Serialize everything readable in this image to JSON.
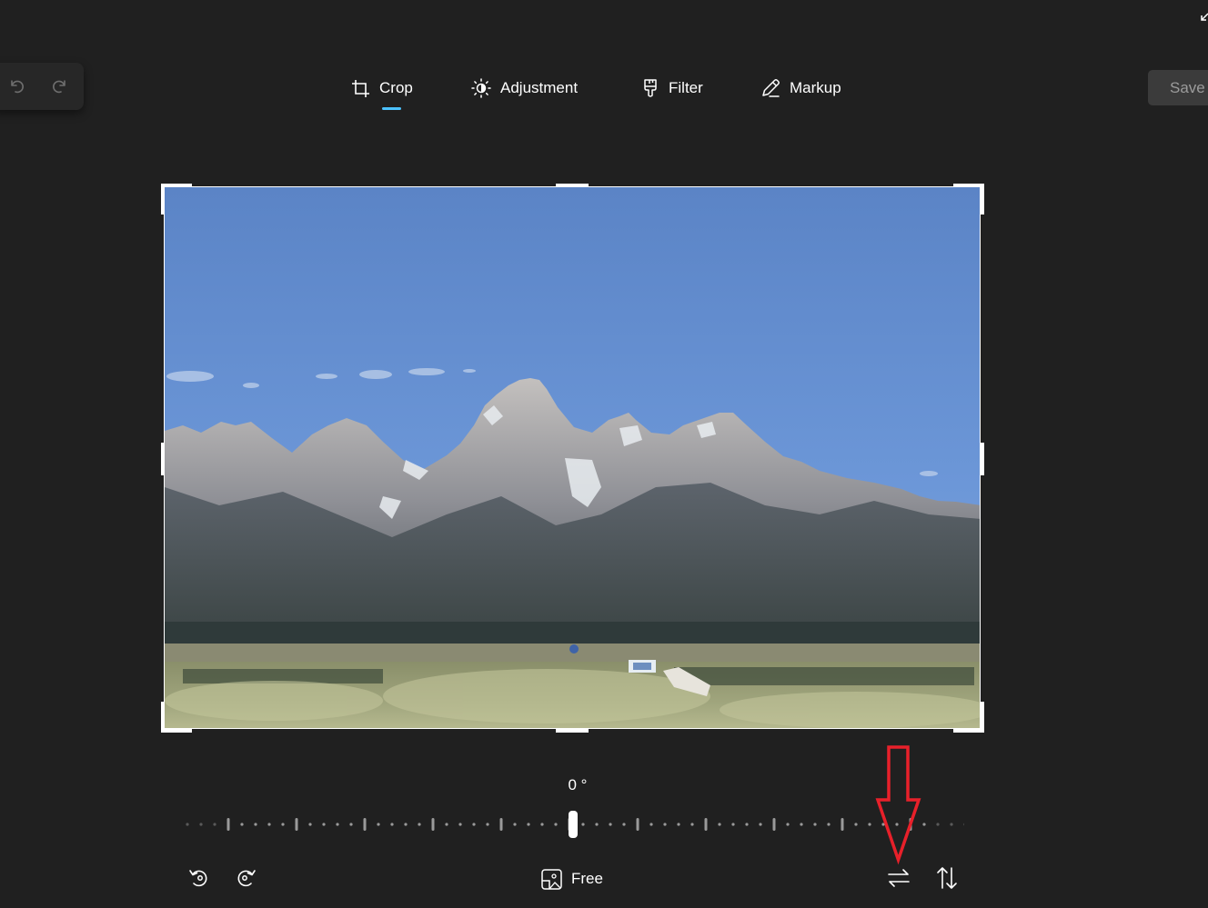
{
  "toolbar": {
    "tabs": [
      {
        "label": "Crop",
        "icon": "crop-icon",
        "active": true
      },
      {
        "label": "Adjustment",
        "icon": "brightness-icon",
        "active": false
      },
      {
        "label": "Filter",
        "icon": "filter-brush-icon",
        "active": false
      },
      {
        "label": "Markup",
        "icon": "pen-icon",
        "active": false
      }
    ],
    "save_label": "Save"
  },
  "history": {
    "undo_icon": "undo-icon",
    "redo_icon": "redo-icon"
  },
  "rotation": {
    "value": "0 °",
    "angle_degrees": 0
  },
  "bottom_tools": {
    "rotate_left_icon": "rotate-left-icon",
    "rotate_right_icon": "rotate-right-icon",
    "aspect_ratio_label": "Free",
    "aspect_ratio_icon": "aspect-ratio-icon",
    "flip_horizontal_icon": "flip-horizontal-icon",
    "flip_vertical_icon": "flip-vertical-icon"
  },
  "colors": {
    "background": "#202020",
    "accent": "#4cc2ff",
    "annotation": "#e8202a",
    "save_bg": "#3b3b3b",
    "save_text": "#9b9b9b"
  }
}
